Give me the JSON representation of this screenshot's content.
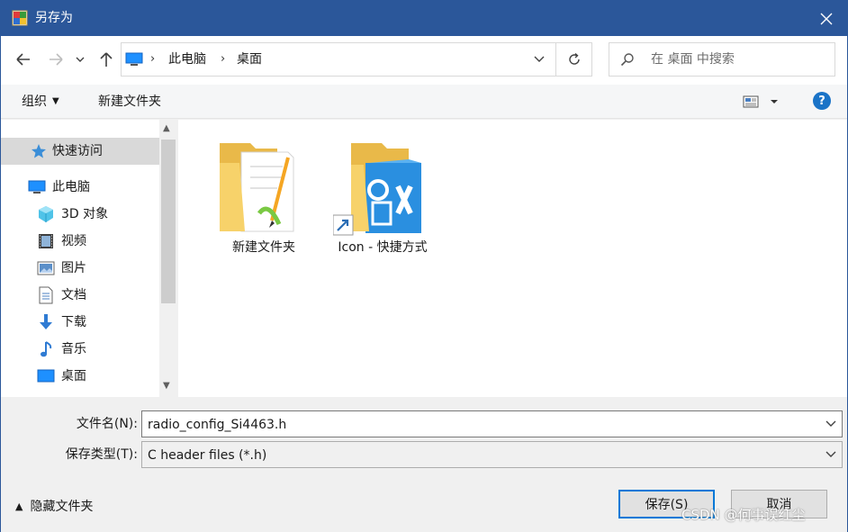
{
  "window": {
    "title": "另存为",
    "icon": "save-as-app-icon",
    "accent_color": "#2b579a"
  },
  "address_bar": {
    "breadcrumb": [
      "此电脑",
      "桌面"
    ],
    "search_placeholder": "在 桌面 中搜索"
  },
  "toolbar": {
    "organize_label": "组织",
    "new_folder_label": "新建文件夹"
  },
  "nav_pane": {
    "items": [
      {
        "label": "快速访问",
        "icon": "quick-access-star-icon",
        "selected": true
      },
      {
        "label": "此电脑",
        "icon": "this-pc-icon",
        "selected": false
      },
      {
        "label": "3D 对象",
        "icon": "3d-objects-icon",
        "selected": false
      },
      {
        "label": "视频",
        "icon": "videos-icon",
        "selected": false
      },
      {
        "label": "图片",
        "icon": "pictures-icon",
        "selected": false
      },
      {
        "label": "文档",
        "icon": "documents-icon",
        "selected": false
      },
      {
        "label": "下载",
        "icon": "downloads-icon",
        "selected": false
      },
      {
        "label": "音乐",
        "icon": "music-icon",
        "selected": false
      },
      {
        "label": "桌面",
        "icon": "desktop-icon",
        "selected": false
      }
    ]
  },
  "files": [
    {
      "name": "新建文件夹",
      "type": "folder",
      "icon": "folder-with-document-icon"
    },
    {
      "name": "Icon - 快捷方式",
      "type": "shortcut",
      "icon": "folder-shortcut-icon"
    }
  ],
  "save_panel": {
    "filename_label": "文件名(N):",
    "filename_value": "radio_config_Si4463.h",
    "filetype_label": "保存类型(T):",
    "filetype_value": "C header files (*.h)",
    "hide_folders_label": "隐藏文件夹",
    "save_label": "保存(S)",
    "cancel_label": "取消"
  },
  "watermark": "CSDN @何事误红尘"
}
